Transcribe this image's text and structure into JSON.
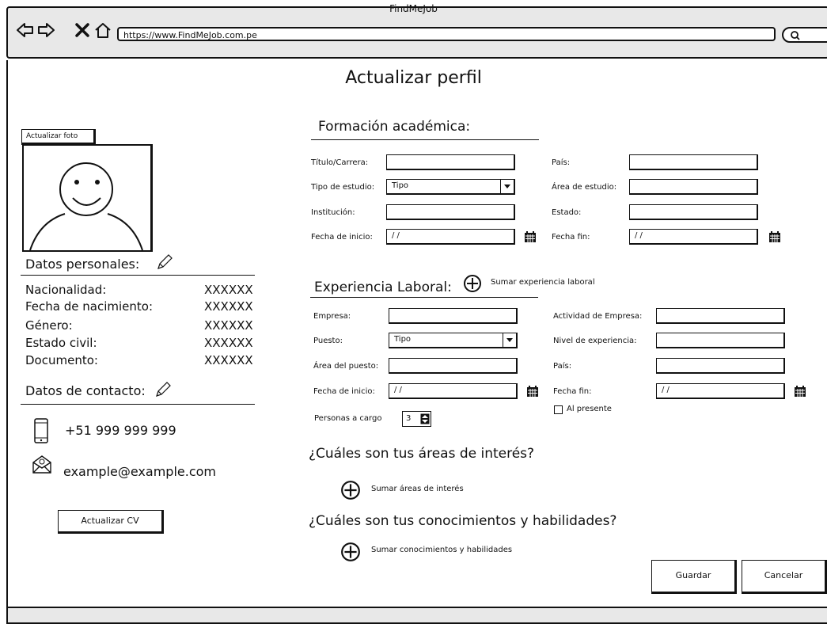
{
  "window": {
    "title": "FindMeJob",
    "url": "https://www.FindMeJob.com.pe"
  },
  "page": {
    "title": "Actualizar perfil"
  },
  "left": {
    "photo_button": "Actualizar foto",
    "personal_title": "Datos personales:",
    "personal": [
      {
        "label": "Nacionalidad:",
        "value": "XXXXXX"
      },
      {
        "label": "Fecha de nacimiento:",
        "value": "XXXXXX"
      },
      {
        "label": "Género:",
        "value": "XXXXXX"
      },
      {
        "label": "Estado civil:",
        "value": "XXXXXX"
      },
      {
        "label": "Documento:",
        "value": "XXXXXX"
      }
    ],
    "contact_title": "Datos de contacto:",
    "phone": "+51 999 999 999",
    "email": "example@example.com",
    "cv_button": "Actualizar CV"
  },
  "education": {
    "title": "Formación académica:",
    "titulo_label": "Título/Carrera:",
    "pais_label": "País:",
    "tipo_label": "Tipo de estudio:",
    "tipo_value": "Tipo",
    "area_label": "Área de estudio:",
    "institucion_label": "Institución:",
    "estado_label": "Estado:",
    "inicio_label": "Fecha de inicio:",
    "inicio_value": "/ /",
    "fin_label": "Fecha fin:",
    "fin_value": "/ /"
  },
  "experience": {
    "title": "Experiencia Laboral:",
    "add_label": "Sumar experiencia laboral",
    "empresa_label": "Empresa:",
    "actividad_label": "Actividad de Empresa:",
    "puesto_label": "Puesto:",
    "puesto_value": "Tipo",
    "nivel_label": "Nivel de experiencia:",
    "area_label": "Área del puesto:",
    "pais_label": "País:",
    "inicio_label": "Fecha de inicio:",
    "inicio_value": "/ /",
    "fin_label": "Fecha fin:",
    "fin_value": "/ /",
    "presente_label": "Al presente",
    "personas_label": "Personas a cargo",
    "personas_value": "3"
  },
  "interests": {
    "question": "¿Cuáles son tus áreas de interés?",
    "add_label": "Sumar áreas de interés"
  },
  "skills": {
    "question": "¿Cuáles son tus conocimientos y habilidades?",
    "add_label": "Sumar conocimientos y habilidades"
  },
  "actions": {
    "save": "Guardar",
    "cancel": "Cancelar"
  }
}
